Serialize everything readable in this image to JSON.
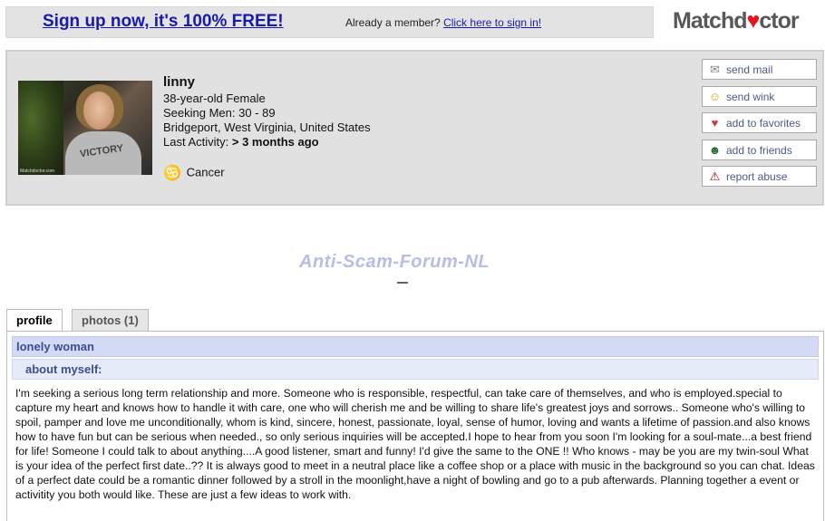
{
  "signup": {
    "cta": "Sign up now, it's 100% FREE!",
    "member_prompt": "Already a member?",
    "signin_link": "Click here to sign in!"
  },
  "logo": {
    "text_before": "Matchd",
    "text_after": "ctor"
  },
  "profile": {
    "name": "linny",
    "age_gender": "38-year-old Female",
    "seeking": "Seeking Men: 30 - 89",
    "location": "Bridgeport, West Virginia, United States",
    "last_activity_label": "Last Activity:",
    "last_activity_value": "> 3 months ago",
    "zodiac": "Cancer",
    "photo_shirt_text": "VICTORY",
    "photo_watermark": "Matchdoctor.com"
  },
  "actions": {
    "send_mail": "send mail",
    "send_wink": "send wink",
    "add_favorites": "add to favorites",
    "add_friends": "add to friends",
    "report_abuse": "report abuse"
  },
  "watermark": "Anti-Scam-Forum-NL",
  "tabs": {
    "profile": "profile",
    "photos": "photos (1)"
  },
  "content": {
    "heading": "lonely woman",
    "subheading": "about myself:",
    "about": "I'm seeking a serious long term relationship and more. Someone who is responsible, respectful, can take care of themselves, and who is employed.special to capture my heart and knows how to handle it with care, one who will cherish me and be willing to share life's greatest joys and sorrows.. Someone who's willing to spoil, pamper and love me unconditionally, whom is kind, sincere, honest, passionate, loyal, sense of humor, loving and wants a lifetime of passion.and also knows how to have fun but can be serious when needed., so only serious inquiries will be accepted.I hope to hear from you soon I'm looking for a soul-mate...a best friend for life! Someone I could talk to about anything....A good listener, smart and funny! I'd give the same to the ONE !! Who knows - may be you are my twin-soul What is your idea of the perfect first date..?? It is always good to meet in a neutral place like a coffee shop or a place with music in the background so you can chat. Ideas of a perfect date could be a romantic dinner followed by a stroll in the moonlight,have a night of bowling and go to a pub afterwards. Planning together a event or activitity you both would like. These are just a few ideas to work with."
  }
}
